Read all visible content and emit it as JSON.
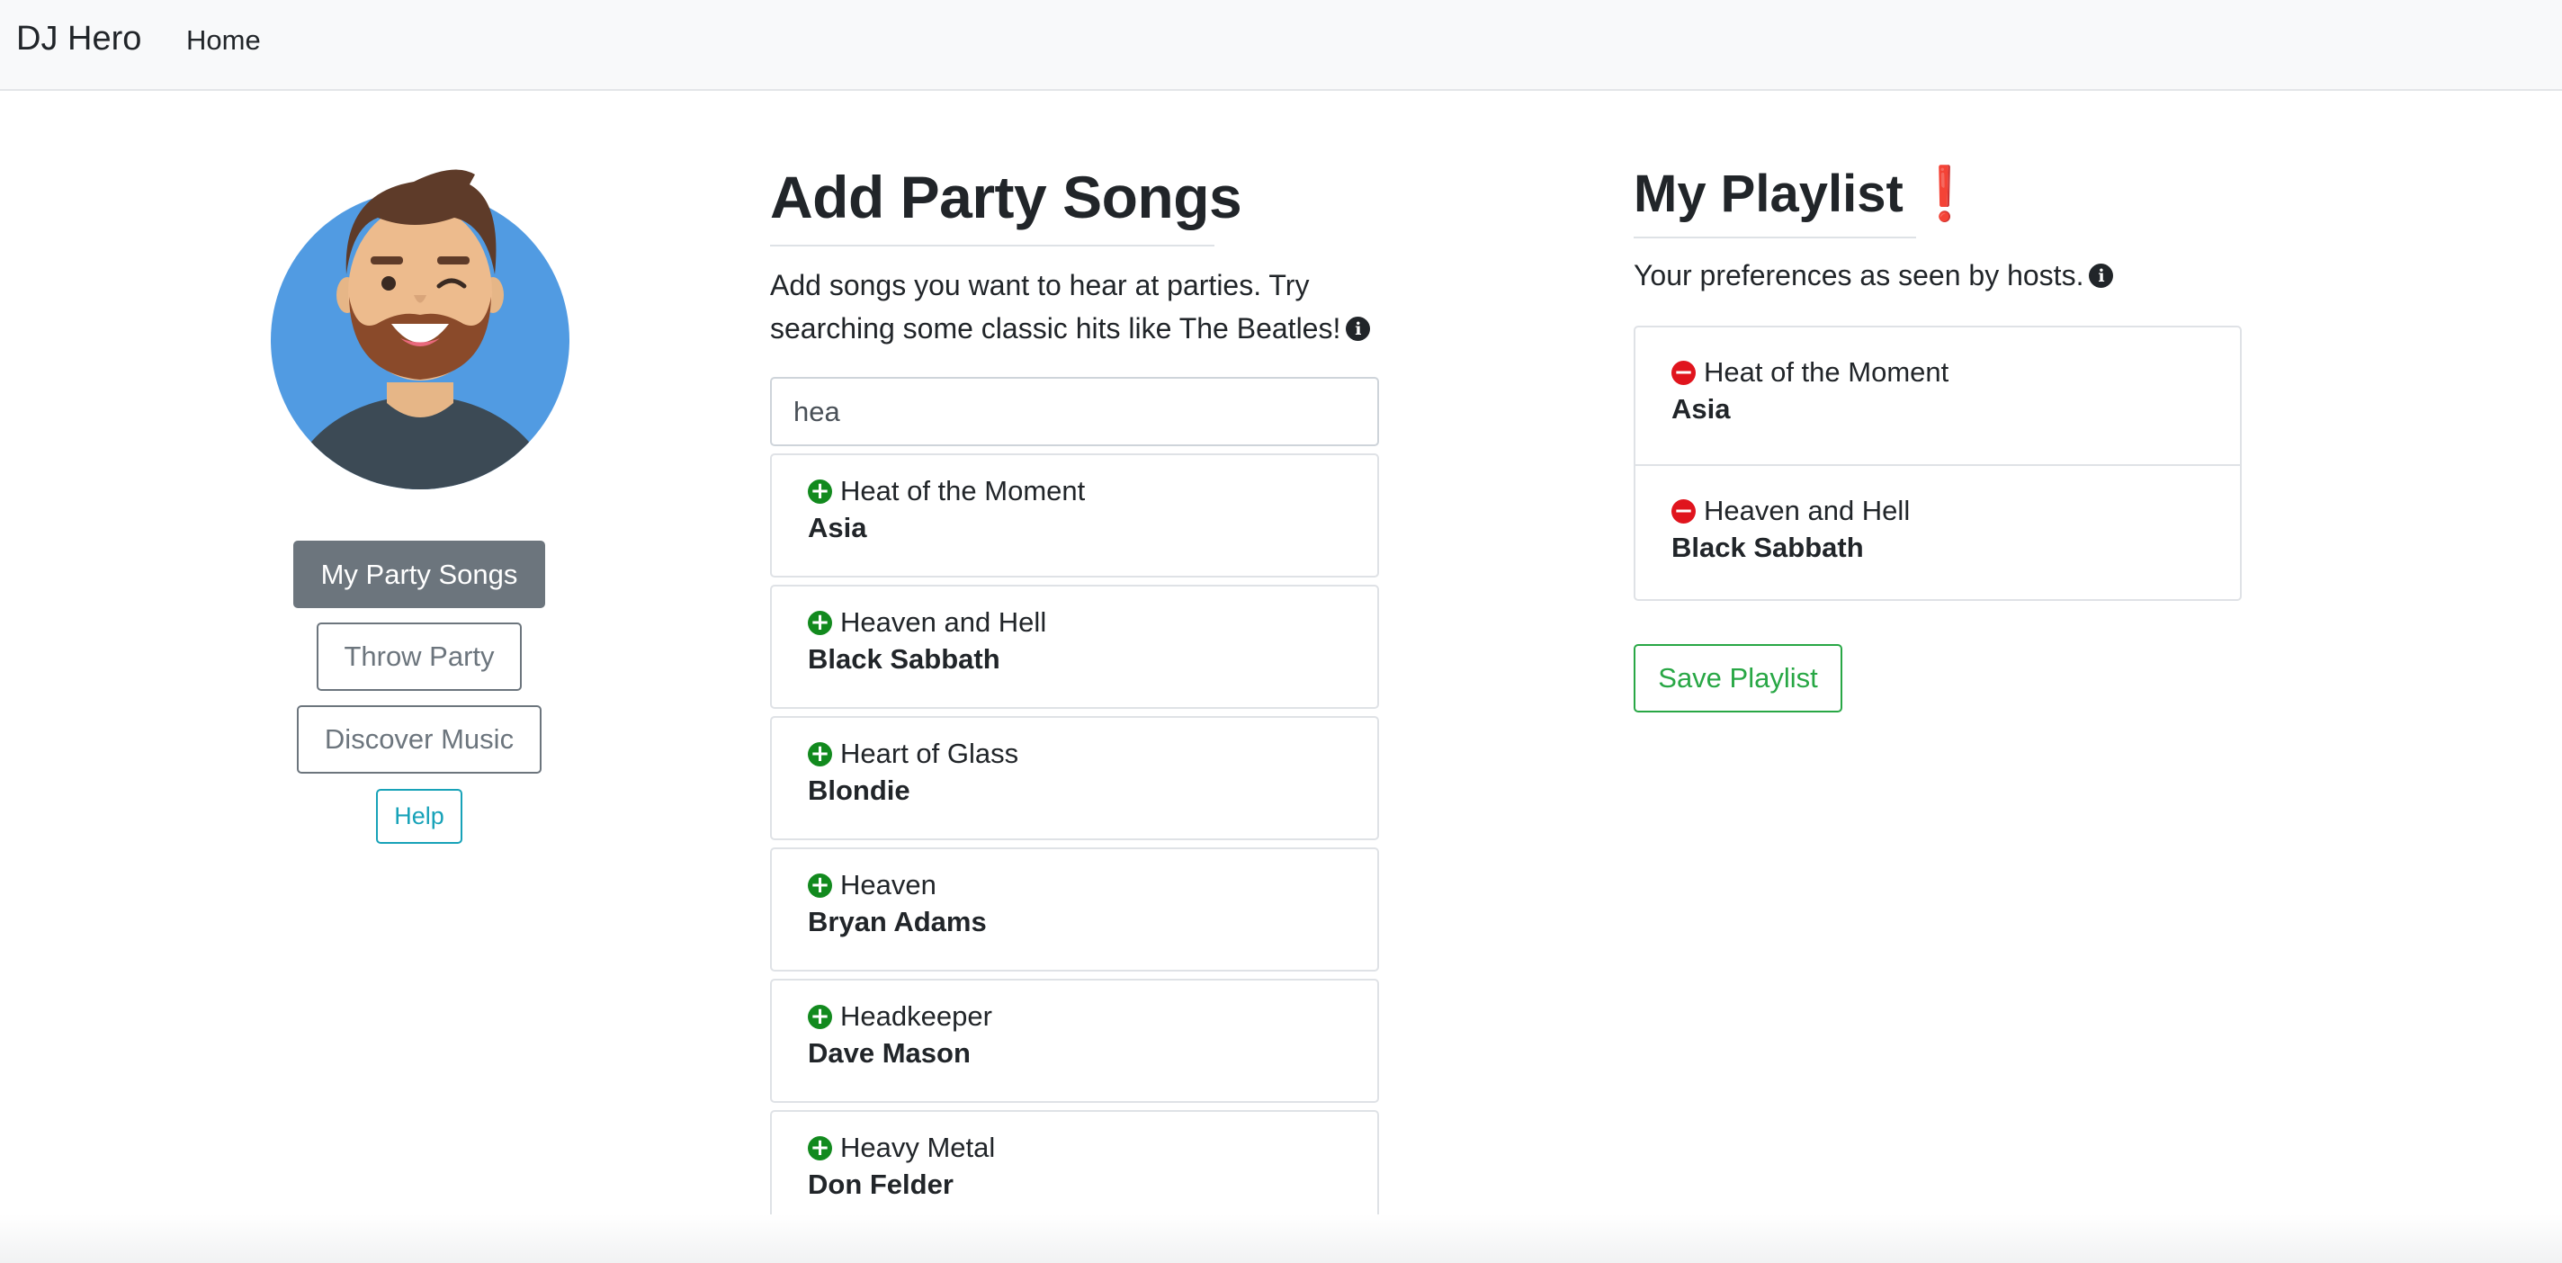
{
  "navbar": {
    "brand": "DJ Hero",
    "home": "Home"
  },
  "sidebar": {
    "buttons": [
      {
        "label": "My Party Songs",
        "active": true
      },
      {
        "label": "Throw Party"
      },
      {
        "label": "Discover Music"
      },
      {
        "label": "Help"
      }
    ]
  },
  "add_songs": {
    "title": "Add Party Songs",
    "description": "Add songs you want to hear at parties. Try searching some classic hits like The Beatles!",
    "search_value": "hea",
    "results": [
      {
        "song": "Heat of the Moment",
        "artist": "Asia"
      },
      {
        "song": "Heaven and Hell",
        "artist": "Black Sabbath"
      },
      {
        "song": "Heart of Glass",
        "artist": "Blondie"
      },
      {
        "song": "Heaven",
        "artist": "Bryan Adams"
      },
      {
        "song": "Headkeeper",
        "artist": "Dave Mason"
      },
      {
        "song": "Heavy Metal",
        "artist": "Don Felder"
      }
    ]
  },
  "playlist": {
    "title": "My Playlist",
    "title_mark": "❗",
    "description": "Your preferences as seen by hosts.",
    "items": [
      {
        "song": "Heat of the Moment",
        "artist": "Asia"
      },
      {
        "song": "Heaven and Hell",
        "artist": "Black Sabbath"
      }
    ],
    "save_label": "Save Playlist"
  },
  "icons": {
    "info": "info-circle-icon",
    "add": "plus-circle-icon",
    "remove": "minus-circle-icon"
  },
  "colors": {
    "navbar_bg": "#f8f9fa",
    "active_button": "#6c757d",
    "help": "#17a2b8",
    "add": "#128a1e",
    "remove": "#e0141d",
    "save": "#28a745",
    "avatar_bg": "#519be2"
  }
}
